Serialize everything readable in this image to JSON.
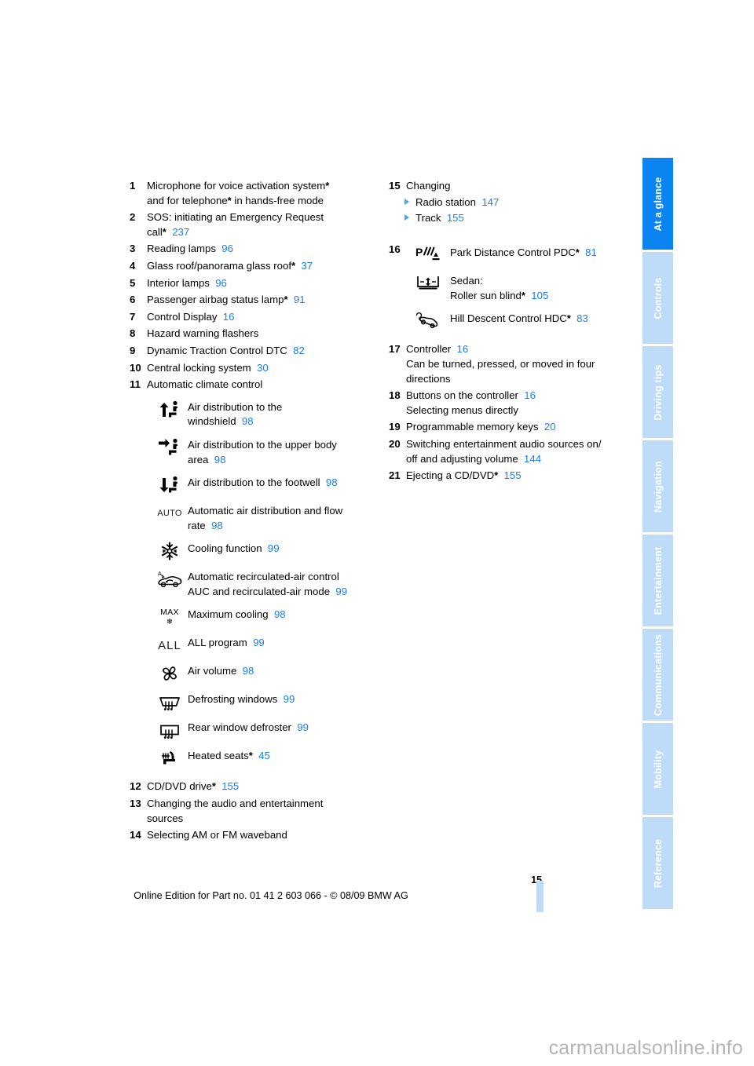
{
  "page": {
    "number": "15",
    "footer_note": "Online Edition for Part no. 01 41 2 603 066 - © 08/09 BMW AG",
    "watermark": "carmanualsonline.info",
    "accent_blue": "#1a7ee8",
    "tab_active_blue": "#0a84f0",
    "tab_inactive_blue": "#bedcf7"
  },
  "tabs": [
    {
      "label": "At a glance",
      "active": true
    },
    {
      "label": "Controls",
      "active": false
    },
    {
      "label": "Driving tips",
      "active": false
    },
    {
      "label": "Navigation",
      "active": false
    },
    {
      "label": "Entertainment",
      "active": false
    },
    {
      "label": "Communications",
      "active": false
    },
    {
      "label": "Mobility",
      "active": false
    },
    {
      "label": "Reference",
      "active": false
    }
  ],
  "left_column": {
    "items": [
      {
        "num": "1",
        "line1": "Microphone for voice activation system",
        "star1": "*",
        "line2_pre": "and for telephone",
        "star2": "*",
        "line2_post": " in hands-free mode"
      },
      {
        "num": "2",
        "line1": "SOS: initiating an Emergency Request",
        "line2_pre": "call",
        "star2": "*",
        "page": "237"
      },
      {
        "num": "3",
        "line1": "Reading lamps",
        "page": "96"
      },
      {
        "num": "4",
        "line1": "Glass roof/panorama glass roof",
        "star1": "*",
        "page": "37"
      },
      {
        "num": "5",
        "line1": "Interior lamps",
        "page": "96"
      },
      {
        "num": "6",
        "line1": "Passenger airbag status lamp",
        "star1": "*",
        "page": "91"
      },
      {
        "num": "7",
        "line1": "Control Display",
        "page": "16"
      },
      {
        "num": "8",
        "line1": "Hazard warning flashers"
      },
      {
        "num": "9",
        "line1": "Dynamic Traction Control DTC",
        "page": "82"
      },
      {
        "num": "10",
        "line1": "Central locking system",
        "page": "30"
      },
      {
        "num": "11",
        "line1": "Automatic climate control"
      }
    ],
    "climate_icons": [
      {
        "icon": "air-distribution-windshield-icon",
        "label_line1": "Air distribution to the",
        "label_line2": "windshield",
        "page": "98"
      },
      {
        "icon": "air-distribution-upper-body-icon",
        "label_line1": "Air distribution to the upper body",
        "label_line2": "area",
        "page": "98"
      },
      {
        "icon": "air-distribution-footwell-icon",
        "label_line1": "Air distribution to the footwell",
        "page": "98"
      },
      {
        "icon": "auto-climate-icon",
        "glyph_text": "AUTO",
        "label_line1": "Automatic air distribution and flow",
        "label_line2": "rate",
        "page": "98"
      },
      {
        "icon": "snowflake-cooling-icon",
        "label_line1": "Cooling function",
        "page": "99"
      },
      {
        "icon": "recirculated-air-auc-icon",
        "label_line1": "Automatic recirculated-air control",
        "label_line2": "AUC and recirculated-air mode",
        "page": "99"
      },
      {
        "icon": "max-cooling-icon",
        "glyph_text": "MAX",
        "label_line1": "Maximum cooling",
        "page": "98"
      },
      {
        "icon": "all-program-icon",
        "glyph_text": "ALL",
        "label_line1": "ALL program",
        "page": "99"
      },
      {
        "icon": "fan-air-volume-icon",
        "label_line1": "Air volume",
        "page": "98"
      },
      {
        "icon": "defrost-windshield-icon",
        "label_line1": "Defrosting windows",
        "page": "99"
      },
      {
        "icon": "rear-window-defroster-icon",
        "label_line1": "Rear window defroster",
        "page": "99"
      },
      {
        "icon": "heated-seats-icon",
        "label_line1": "Heated seats",
        "star": "*",
        "page": "45"
      }
    ],
    "items_after": [
      {
        "num": "12",
        "line1": "CD/DVD drive",
        "star1": "*",
        "page": "155"
      },
      {
        "num": "13",
        "line1": "Changing the audio and entertainment",
        "line2_pre": "sources"
      },
      {
        "num": "14",
        "line1": "Selecting AM or FM waveband"
      }
    ]
  },
  "right_column": {
    "item15": {
      "num": "15",
      "title": "Changing",
      "subitems": [
        {
          "label": "Radio station",
          "page": "147"
        },
        {
          "label": "Track",
          "page": "155"
        }
      ]
    },
    "item16": {
      "num": "16",
      "icons": [
        {
          "icon": "pdc-park-distance-icon",
          "label_line1": "Park Distance Control PDC",
          "star": "*",
          "page": "81"
        },
        {
          "icon": "roller-sun-blind-icon",
          "label_line1": "Sedan:",
          "label_line2": "Roller sun blind",
          "star": "*",
          "page": "105"
        },
        {
          "icon": "hill-descent-control-icon",
          "label_line1": "Hill Descent Control HDC",
          "star": "*",
          "page": "83"
        }
      ]
    },
    "items": [
      {
        "num": "17",
        "line1": "Controller",
        "page": "16",
        "line2": "Can be turned, pressed, or moved in four",
        "line3": "directions"
      },
      {
        "num": "18",
        "line1": "Buttons on the controller",
        "page": "16",
        "line2": "Selecting menus directly"
      },
      {
        "num": "19",
        "line1": "Programmable memory keys",
        "page": "20"
      },
      {
        "num": "20",
        "line1": "Switching entertainment audio sources on/",
        "line2": "off and adjusting volume",
        "page2": "144"
      },
      {
        "num": "21",
        "line1": "Ejecting a CD/DVD",
        "star1": "*",
        "page": "155"
      }
    ]
  }
}
